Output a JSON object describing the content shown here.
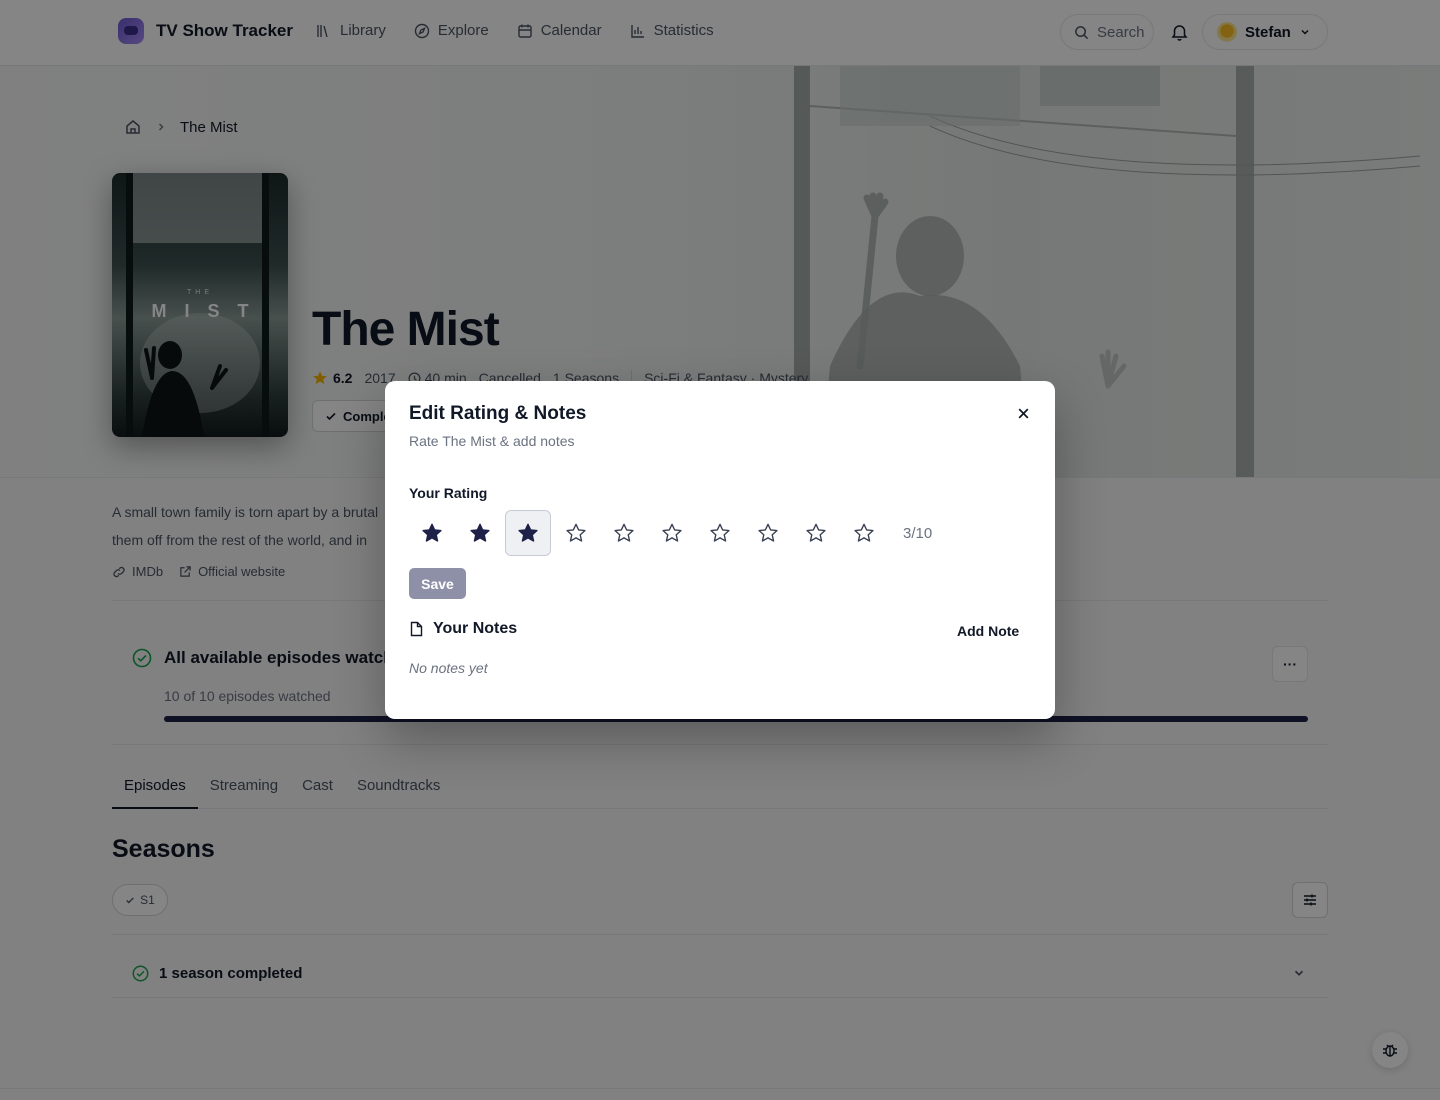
{
  "app": {
    "name": "TV Show Tracker"
  },
  "nav": {
    "items": [
      {
        "label": "Library",
        "icon": "library-icon"
      },
      {
        "label": "Explore",
        "icon": "compass-icon"
      },
      {
        "label": "Calendar",
        "icon": "calendar-icon"
      },
      {
        "label": "Statistics",
        "icon": "bar-chart-icon"
      }
    ],
    "search_label": "Search",
    "user_name": "Stefan"
  },
  "breadcrumb": {
    "current": "The Mist"
  },
  "show": {
    "title": "The Mist",
    "poster_title": "MIST",
    "poster_the": "THE",
    "rating": "6.2",
    "year": "2017",
    "runtime": "40 min",
    "status": "Cancelled",
    "seasons_count": "1 Seasons",
    "genres": "Sci-Fi & Fantasy · Mystery",
    "status_button": "Completed",
    "overview_line1": "A small town family is torn apart by a brutal",
    "overview_line2": "them off from the rest of the world, and in",
    "link_imdb": "IMDb",
    "link_website": "Official website"
  },
  "progress": {
    "title": "All available episodes watched",
    "subtitle": "10 of 10 episodes watched",
    "fraction": 1.0,
    "more_label": "···"
  },
  "tabs": [
    {
      "label": "Episodes",
      "active": true
    },
    {
      "label": "Streaming",
      "active": false
    },
    {
      "label": "Cast",
      "active": false
    },
    {
      "label": "Soundtracks",
      "active": false
    }
  ],
  "seasons": {
    "title": "Seasons",
    "chip": "S1",
    "summary": "1 season completed"
  },
  "modal": {
    "title": "Edit Rating & Notes",
    "subtitle": "Rate The Mist & add notes",
    "rating_label": "Your Rating",
    "rating": 3,
    "max_rating": 10,
    "rating_text": "3/10",
    "save_label": "Save",
    "notes_title": "Your Notes",
    "add_note_label": "Add Note",
    "empty_notes": "No notes yet"
  },
  "colors": {
    "accent": "#1e2148",
    "star_filled": "#1e2148",
    "rating_star": "#f5b301",
    "success": "#16a34a"
  }
}
